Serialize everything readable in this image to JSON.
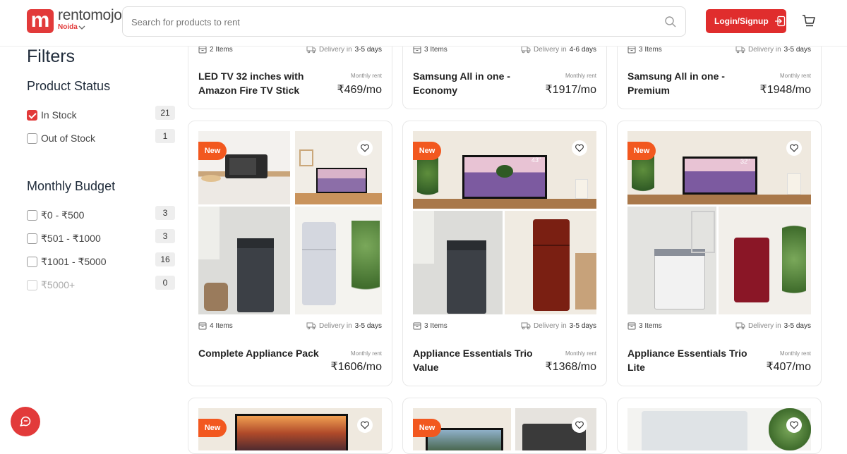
{
  "brand": {
    "name": "rentomojo",
    "logo_letter": "m",
    "city": "Noida"
  },
  "search": {
    "placeholder": "Search for products to rent"
  },
  "header": {
    "login_label": "Login/Signup"
  },
  "filters": {
    "title": "Filters",
    "product_status": {
      "title": "Product Status",
      "options": [
        {
          "label": "In Stock",
          "count": "21",
          "checked": true
        },
        {
          "label": "Out of Stock",
          "count": "1",
          "checked": false
        }
      ]
    },
    "monthly_budget": {
      "title": "Monthly Budget",
      "options": [
        {
          "label": "₹0 - ₹500",
          "count": "3"
        },
        {
          "label": "₹501 - ₹1000",
          "count": "3"
        },
        {
          "label": "₹1001 - ₹5000",
          "count": "16"
        },
        {
          "label": "₹5000+",
          "count": "0",
          "disabled": true
        }
      ]
    }
  },
  "products": [
    {
      "name": "LED TV 32 inches with Amazon Fire TV Stick",
      "items": "2 Items",
      "delivery_prefix": "Delivery in",
      "delivery_days": "3-5 days",
      "rent_label": "Monthly rent",
      "price": "₹469/mo"
    },
    {
      "name": "Samsung All in one - Economy",
      "items": "3 Items",
      "delivery_prefix": "Delivery in",
      "delivery_days": "4-6 days",
      "rent_label": "Monthly rent",
      "price": "₹1917/mo"
    },
    {
      "name": "Samsung All in one - Premium",
      "items": "3 Items",
      "delivery_prefix": "Delivery in",
      "delivery_days": "3-5 days",
      "rent_label": "Monthly rent",
      "price": "₹1948/mo"
    },
    {
      "name": "Complete Appliance Pack",
      "items": "4 Items",
      "delivery_prefix": "Delivery in",
      "delivery_days": "3-5 days",
      "rent_label": "Monthly rent",
      "price": "₹1606/mo",
      "badge": "New"
    },
    {
      "name": "Appliance Essentials Trio Value",
      "items": "3 Items",
      "delivery_prefix": "Delivery in",
      "delivery_days": "3-5 days",
      "rent_label": "Monthly rent",
      "price": "₹1368/mo",
      "badge": "New",
      "tv_size": "43\""
    },
    {
      "name": "Appliance Essentials Trio Lite",
      "items": "3 Items",
      "delivery_prefix": "Delivery in",
      "delivery_days": "3-5 days",
      "rent_label": "Monthly rent",
      "price": "₹407/mo",
      "badge": "New",
      "tv_size": "32\""
    },
    {
      "badge": "New"
    },
    {
      "badge": "New"
    },
    {}
  ],
  "colors": {
    "brand_red": "#e23a3a",
    "badge_orange": "#f2581f"
  }
}
